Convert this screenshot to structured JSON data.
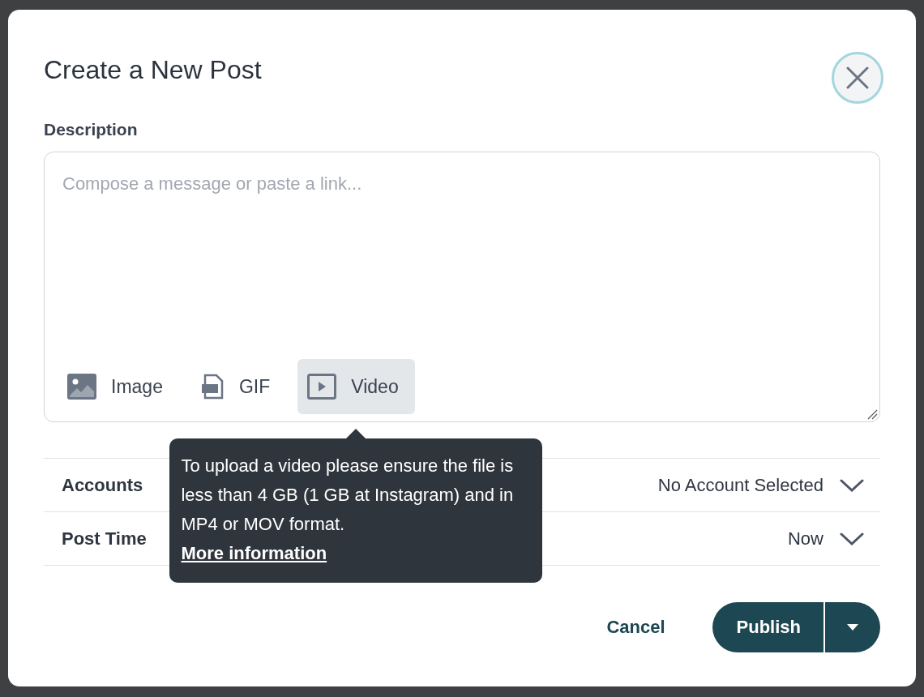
{
  "title": "Create a New Post",
  "description": {
    "label": "Description",
    "placeholder": "Compose a message or paste a link..."
  },
  "media_buttons": [
    {
      "kind": "image",
      "label": "Image",
      "selected": false
    },
    {
      "kind": "gif",
      "label": "GIF",
      "selected": false
    },
    {
      "kind": "video",
      "label": "Video",
      "selected": true
    }
  ],
  "tooltip": {
    "text": "To upload a video please ensure the file is less than 4 GB (1 GB at Instagram) and in MP4 or MOV format.",
    "link": "More information"
  },
  "settings": [
    {
      "label": "Accounts",
      "value": "No Account Selected"
    },
    {
      "label": "Post Time",
      "value": "Now"
    }
  ],
  "actions": {
    "cancel": "Cancel",
    "publish": "Publish"
  }
}
